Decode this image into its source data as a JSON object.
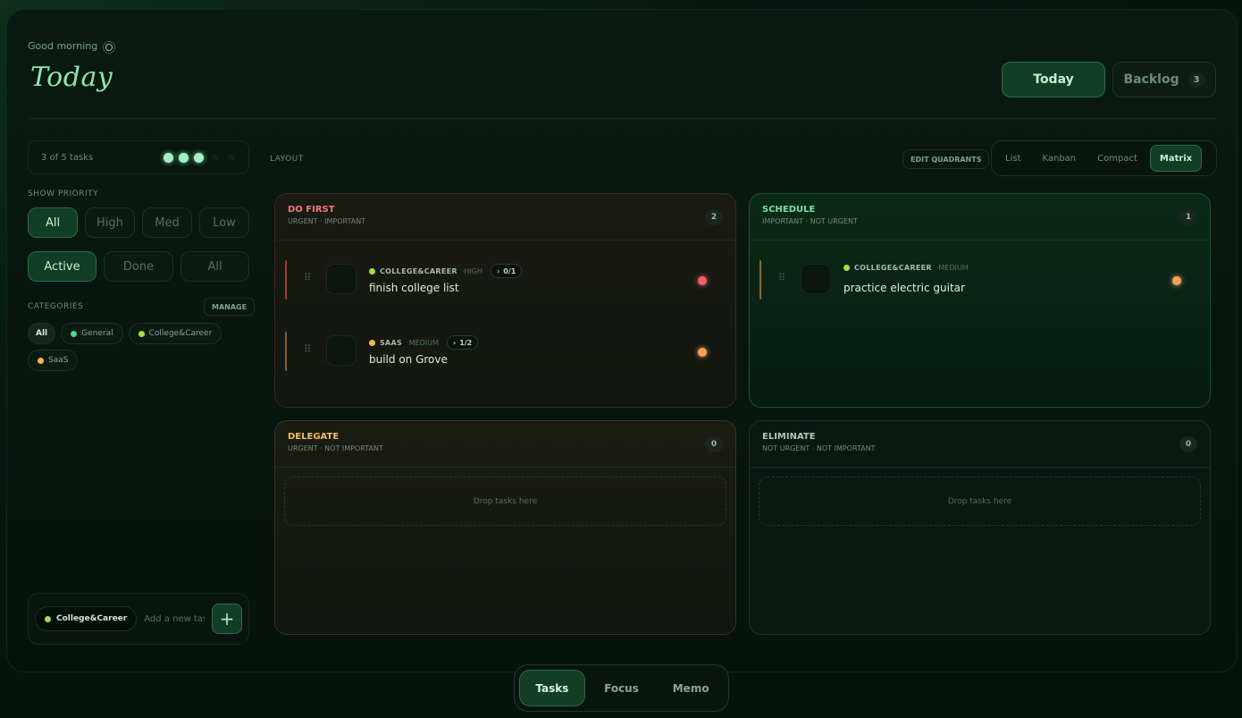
{
  "header": {
    "greeting": "Good morning",
    "title": "Today",
    "tabs": [
      {
        "label": "Today",
        "active": true
      },
      {
        "label": "Backlog",
        "count": "3",
        "active": false
      }
    ]
  },
  "sidebar": {
    "progress_text": "3 of 5 tasks",
    "progress": {
      "done": 3,
      "total": 5
    },
    "priority_label": "SHOW PRIORITY",
    "priority": [
      "All",
      "High",
      "Med",
      "Low"
    ],
    "status": [
      "Active",
      "Done",
      "All"
    ],
    "categories_label": "CATEGORIES",
    "manage_label": "MANAGE",
    "categories": [
      {
        "label": "All",
        "color": ""
      },
      {
        "label": "General",
        "color": "#4fd38a"
      },
      {
        "label": "College&Career",
        "color": "#a6e23a"
      },
      {
        "label": "SaaS",
        "color": "#f5b942"
      }
    ],
    "add": {
      "category": "College&Career",
      "category_color": "#a6e23a",
      "placeholder": "Add a new task",
      "button": "+"
    }
  },
  "layout": {
    "label": "LAYOUT",
    "edit_label": "EDIT QUADRANTS",
    "tabs": [
      "List",
      "Kanban",
      "Compact",
      "Matrix"
    ],
    "active": "Matrix"
  },
  "quadrants": {
    "do_first": {
      "title": "DO FIRST",
      "subtitle": "URGENT · IMPORTANT",
      "count": "2",
      "color": "#f07878",
      "tasks": [
        {
          "category": "COLLEGE&CAREER",
          "priority": "·HIGH",
          "subtasks": "0/1",
          "name": "finish college list",
          "cat_color": "#a6e23a",
          "flag_color": "#f0606a",
          "bar_color": "#a33a3a"
        },
        {
          "category": "SAAS",
          "priority": "·MEDIUM",
          "subtasks": "1/2",
          "name": "build on Grove",
          "cat_color": "#f5b942",
          "flag_color": "#f5a15a",
          "bar_color": "#8a5f30"
        }
      ]
    },
    "schedule": {
      "title": "SCHEDULE",
      "subtitle": "IMPORTANT · NOT URGENT",
      "count": "1",
      "color": "#7fe0a6",
      "tasks": [
        {
          "category": "COLLEGE&CAREER",
          "priority": "·MEDIUM",
          "name": "practice electric guitar",
          "cat_color": "#a6e23a",
          "flag_color": "#f5a15a",
          "bar_color": "#8a6a30"
        }
      ]
    },
    "delegate": {
      "title": "DELEGATE",
      "subtitle": "URGENT · NOT IMPORTANT",
      "count": "0",
      "color": "#f5b96a",
      "drop": "Drop tasks here"
    },
    "eliminate": {
      "title": "ELIMINATE",
      "subtitle": "NOT URGENT · NOT IMPORTANT",
      "count": "0",
      "color": "#b4c4ba",
      "drop": "Drop tasks here"
    }
  },
  "bottom_nav": {
    "tabs": [
      "Tasks",
      "Focus",
      "Memo"
    ],
    "active": "Tasks"
  }
}
